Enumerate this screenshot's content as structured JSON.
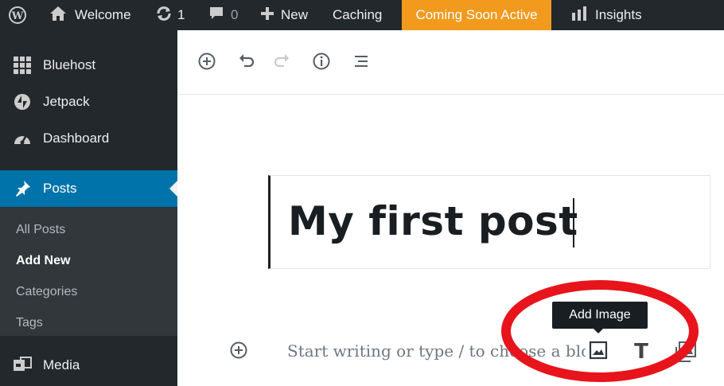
{
  "adminbar": {
    "site_name": "Welcome",
    "updates_count": "1",
    "comments_count": "0",
    "new_label": "New",
    "caching_label": "Caching",
    "coming_soon_label": "Coming Soon Active",
    "insights_label": "Insights"
  },
  "sidebar": {
    "items": [
      {
        "label": "Bluehost",
        "icon": "grid-icon"
      },
      {
        "label": "Jetpack",
        "icon": "jetpack-icon"
      },
      {
        "label": "Dashboard",
        "icon": "dashboard-icon"
      },
      {
        "label": "Posts",
        "icon": "pin-icon"
      },
      {
        "label": "Media",
        "icon": "media-icon"
      }
    ],
    "posts_submenu": [
      "All Posts",
      "Add New",
      "Categories",
      "Tags"
    ]
  },
  "editor": {
    "post_title": "My first post",
    "placeholder": "Start writing or type / to choose a block",
    "tooltip": "Add Image",
    "heading_glyph": "T"
  },
  "colors": {
    "admin_bg": "#23282d",
    "submenu_bg": "#32373c",
    "active_blue": "#0073aa",
    "coming_soon_orange": "#f29a1e",
    "highlight_red": "#e8141b"
  }
}
